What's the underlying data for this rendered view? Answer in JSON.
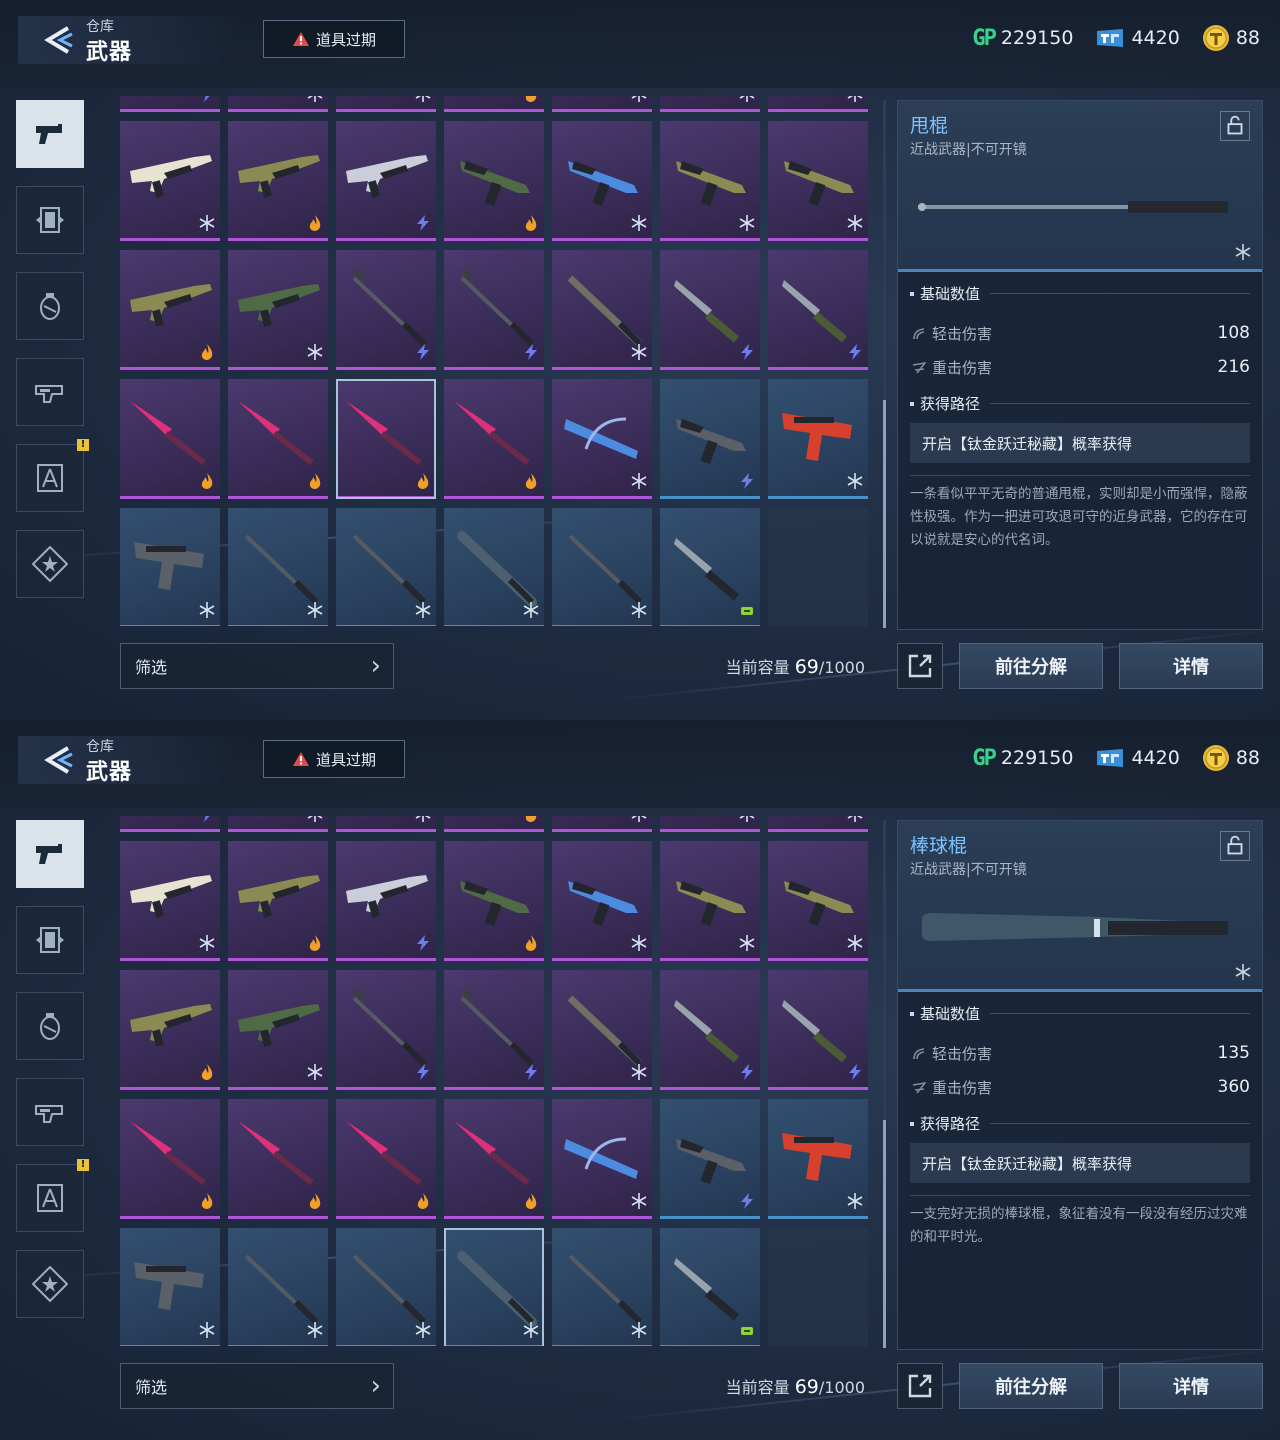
{
  "screens": [
    {
      "breadcrumb": {
        "parent": "仓库",
        "current": "武器"
      },
      "expire_button": "道具过期",
      "currencies": {
        "gp_label": "GP",
        "gp": "229150",
        "ticket": "4420",
        "coin": "88"
      },
      "sidebar": [
        {
          "icon": "pistol-icon",
          "active": true,
          "badge": false
        },
        {
          "icon": "skin-frame-icon",
          "active": false,
          "badge": false
        },
        {
          "icon": "grenade-icon",
          "active": false,
          "badge": false
        },
        {
          "icon": "weapon-part-icon",
          "active": false,
          "badge": false
        },
        {
          "icon": "blueprint-compass-icon",
          "active": false,
          "badge": true
        },
        {
          "icon": "star-badge-icon",
          "active": false,
          "badge": false
        }
      ],
      "badge_text": "!",
      "grid": {
        "selected_index": 23,
        "cells": [
          {
            "rarity": "purple",
            "weapon": "rifle",
            "tag": "lightning"
          },
          {
            "rarity": "purple",
            "weapon": "rifle",
            "tag": "snowflake"
          },
          {
            "rarity": "purple",
            "weapon": "rifle",
            "tag": "snowflake"
          },
          {
            "rarity": "purple",
            "weapon": "rifle",
            "tag": "fire"
          },
          {
            "rarity": "purple",
            "weapon": "rifle",
            "tag": "snowflake"
          },
          {
            "rarity": "purple",
            "weapon": "rifle",
            "tag": "snowflake"
          },
          {
            "rarity": "purple",
            "weapon": "rifle",
            "tag": "snowflake"
          },
          {
            "rarity": "purple",
            "weapon": "rifle-white",
            "tag": "snowflake"
          },
          {
            "rarity": "purple",
            "weapon": "rifle-olive",
            "tag": "fire"
          },
          {
            "rarity": "purple",
            "weapon": "rifle-silver",
            "tag": "lightning"
          },
          {
            "rarity": "purple",
            "weapon": "smg-green",
            "tag": "fire"
          },
          {
            "rarity": "purple",
            "weapon": "smg-blue",
            "tag": "snowflake"
          },
          {
            "rarity": "purple",
            "weapon": "smg-olive",
            "tag": "snowflake"
          },
          {
            "rarity": "purple",
            "weapon": "smg-olive",
            "tag": "snowflake"
          },
          {
            "rarity": "purple",
            "weapon": "lmg-olive",
            "tag": "fire"
          },
          {
            "rarity": "purple",
            "weapon": "rifle-green",
            "tag": "snowflake"
          },
          {
            "rarity": "purple",
            "weapon": "hammer",
            "tag": "lightning"
          },
          {
            "rarity": "purple",
            "weapon": "hammer",
            "tag": "lightning"
          },
          {
            "rarity": "purple",
            "weapon": "blade",
            "tag": "snowflake"
          },
          {
            "rarity": "purple",
            "weapon": "knife",
            "tag": "lightning"
          },
          {
            "rarity": "purple",
            "weapon": "knife",
            "tag": "lightning"
          },
          {
            "rarity": "purple",
            "weapon": "spear-pink",
            "tag": "fire"
          },
          {
            "rarity": "purple",
            "weapon": "spear-pink",
            "tag": "fire"
          },
          {
            "rarity": "purple",
            "weapon": "spear-pink",
            "tag": "fire"
          },
          {
            "rarity": "purple",
            "weapon": "spear-pink",
            "tag": "fire"
          },
          {
            "rarity": "purple",
            "weapon": "crossbow-blue",
            "tag": "snowflake"
          },
          {
            "rarity": "blue",
            "weapon": "smg-dark",
            "tag": "lightning"
          },
          {
            "rarity": "blue",
            "weapon": "pistol-red",
            "tag": "snowflake"
          },
          {
            "rarity": "blue",
            "weapon": "pistol-dark",
            "tag": "snowflake"
          },
          {
            "rarity": "blue",
            "weapon": "baton",
            "tag": "snowflake"
          },
          {
            "rarity": "blue",
            "weapon": "baton",
            "tag": "snowflake"
          },
          {
            "rarity": "blue",
            "weapon": "bat",
            "tag": "snowflake"
          },
          {
            "rarity": "blue",
            "weapon": "baton",
            "tag": "snowflake"
          },
          {
            "rarity": "blue",
            "weapon": "dagger",
            "tag": "key"
          },
          {
            "rarity": "empty",
            "weapon": "",
            "tag": ""
          }
        ]
      },
      "filter_label": "筛选",
      "capacity": {
        "label": "当前容量",
        "current": "69",
        "max": "/1000"
      },
      "detail": {
        "name": "甩棍",
        "type": "近战武器|不可开镜",
        "weapon_image": "baton",
        "section_stats": "基础数值",
        "light_label": "轻击伤害",
        "light_value": "108",
        "heavy_label": "重击伤害",
        "heavy_value": "216",
        "section_source": "获得路径",
        "source": "开启【钛金跃迁秘藏】概率获得",
        "description": "一条看似平平无奇的普通甩棍，实则却是小而强悍，隐蔽性极强。作为一把进可攻退可守的近身武器，它的存在可以说就是安心的代名词。"
      },
      "buttons": {
        "dismantle": "前往分解",
        "details": "详情"
      }
    },
    {
      "breadcrumb": {
        "parent": "仓库",
        "current": "武器"
      },
      "expire_button": "道具过期",
      "currencies": {
        "gp_label": "GP",
        "gp": "229150",
        "ticket": "4420",
        "coin": "88"
      },
      "sidebar": [
        {
          "icon": "pistol-icon",
          "active": true,
          "badge": false
        },
        {
          "icon": "skin-frame-icon",
          "active": false,
          "badge": false
        },
        {
          "icon": "grenade-icon",
          "active": false,
          "badge": false
        },
        {
          "icon": "weapon-part-icon",
          "active": false,
          "badge": false
        },
        {
          "icon": "blueprint-compass-icon",
          "active": false,
          "badge": true
        },
        {
          "icon": "star-badge-icon",
          "active": false,
          "badge": false
        }
      ],
      "badge_text": "!",
      "grid": {
        "selected_index": 31,
        "cells": [
          {
            "rarity": "purple",
            "weapon": "rifle",
            "tag": "lightning"
          },
          {
            "rarity": "purple",
            "weapon": "rifle",
            "tag": "snowflake"
          },
          {
            "rarity": "purple",
            "weapon": "rifle",
            "tag": "snowflake"
          },
          {
            "rarity": "purple",
            "weapon": "rifle",
            "tag": "fire"
          },
          {
            "rarity": "purple",
            "weapon": "rifle",
            "tag": "snowflake"
          },
          {
            "rarity": "purple",
            "weapon": "rifle",
            "tag": "snowflake"
          },
          {
            "rarity": "purple",
            "weapon": "rifle",
            "tag": "snowflake"
          },
          {
            "rarity": "purple",
            "weapon": "rifle-white",
            "tag": "snowflake"
          },
          {
            "rarity": "purple",
            "weapon": "rifle-olive",
            "tag": "fire"
          },
          {
            "rarity": "purple",
            "weapon": "rifle-silver",
            "tag": "lightning"
          },
          {
            "rarity": "purple",
            "weapon": "smg-green",
            "tag": "fire"
          },
          {
            "rarity": "purple",
            "weapon": "smg-blue",
            "tag": "snowflake"
          },
          {
            "rarity": "purple",
            "weapon": "smg-olive",
            "tag": "snowflake"
          },
          {
            "rarity": "purple",
            "weapon": "smg-olive",
            "tag": "snowflake"
          },
          {
            "rarity": "purple",
            "weapon": "lmg-olive",
            "tag": "fire"
          },
          {
            "rarity": "purple",
            "weapon": "rifle-green",
            "tag": "snowflake"
          },
          {
            "rarity": "purple",
            "weapon": "hammer",
            "tag": "lightning"
          },
          {
            "rarity": "purple",
            "weapon": "hammer",
            "tag": "lightning"
          },
          {
            "rarity": "purple",
            "weapon": "blade",
            "tag": "snowflake"
          },
          {
            "rarity": "purple",
            "weapon": "knife",
            "tag": "lightning"
          },
          {
            "rarity": "purple",
            "weapon": "knife",
            "tag": "lightning"
          },
          {
            "rarity": "purple",
            "weapon": "spear-pink",
            "tag": "fire"
          },
          {
            "rarity": "purple",
            "weapon": "spear-pink",
            "tag": "fire"
          },
          {
            "rarity": "purple",
            "weapon": "spear-pink",
            "tag": "fire"
          },
          {
            "rarity": "purple",
            "weapon": "spear-pink",
            "tag": "fire"
          },
          {
            "rarity": "purple",
            "weapon": "crossbow-blue",
            "tag": "snowflake"
          },
          {
            "rarity": "blue",
            "weapon": "smg-dark",
            "tag": "lightning"
          },
          {
            "rarity": "blue",
            "weapon": "pistol-red",
            "tag": "snowflake"
          },
          {
            "rarity": "blue",
            "weapon": "pistol-dark",
            "tag": "snowflake"
          },
          {
            "rarity": "blue",
            "weapon": "baton",
            "tag": "snowflake"
          },
          {
            "rarity": "blue",
            "weapon": "baton",
            "tag": "snowflake"
          },
          {
            "rarity": "blue",
            "weapon": "bat",
            "tag": "snowflake"
          },
          {
            "rarity": "blue",
            "weapon": "baton",
            "tag": "snowflake"
          },
          {
            "rarity": "blue",
            "weapon": "dagger",
            "tag": "key"
          },
          {
            "rarity": "empty",
            "weapon": "",
            "tag": ""
          }
        ]
      },
      "filter_label": "筛选",
      "capacity": {
        "label": "当前容量",
        "current": "69",
        "max": "/1000"
      },
      "detail": {
        "name": "棒球棍",
        "type": "近战武器|不可开镜",
        "weapon_image": "bat",
        "section_stats": "基础数值",
        "light_label": "轻击伤害",
        "light_value": "135",
        "heavy_label": "重击伤害",
        "heavy_value": "360",
        "section_source": "获得路径",
        "source": "开启【钛金跃迁秘藏】概率获得",
        "description": "一支完好无损的棒球棍，象征着没有一段没有经历过灾难的和平时光。"
      },
      "buttons": {
        "dismantle": "前往分解",
        "details": "详情"
      }
    }
  ],
  "colors": {
    "accent_blue": "#7cc3ff",
    "rarity_purple": "#b054d8",
    "rarity_blue": "#4a90c8",
    "gp_green": "#3dd08c",
    "badge_yellow": "#e9c23a"
  }
}
